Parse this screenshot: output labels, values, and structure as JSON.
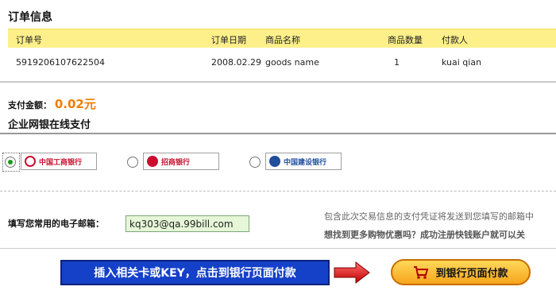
{
  "order": {
    "title": "订单信息",
    "headers": {
      "order_no": "订单号",
      "order_date": "订单日期",
      "product_name": "商品名称",
      "quantity": "商品数量",
      "payer": "付款人"
    },
    "row": {
      "order_no": "5919206107622504",
      "order_date": "2008.02.29",
      "product_name": "goods name",
      "quantity": "1",
      "payer": "kuai qian"
    }
  },
  "payment": {
    "amount_label": "支付金额：",
    "amount_value": "0.02元",
    "section_title": "企业网银在线支付"
  },
  "banks": [
    {
      "name": "中国工商银行",
      "selected": true,
      "color": "#c8102e",
      "icon": "icbc-logo-icon"
    },
    {
      "name": "招商银行",
      "selected": false,
      "color": "#c8102e",
      "icon": "cmb-logo-icon"
    },
    {
      "name": "中国建设银行",
      "selected": false,
      "color": "#1f4e9c",
      "icon": "ccb-logo-icon"
    }
  ],
  "email": {
    "label": "填写您常用的电子邮箱：",
    "value": "kq303@qa.99bill.com",
    "note": "包含此次交易信息的支付凭证将发送到您填写的邮箱中",
    "promo": "想找到更多购物优惠吗？成功注册快钱账户就可以关"
  },
  "footer": {
    "hint": "插入相关卡或KEY，点击到银行页面付款",
    "pay_button": "到银行页面付款"
  },
  "colors": {
    "header_bg": "#fdf08a",
    "amount": "#f07c00",
    "hint_bg": "#1540c8",
    "button": "#f7a51b"
  }
}
